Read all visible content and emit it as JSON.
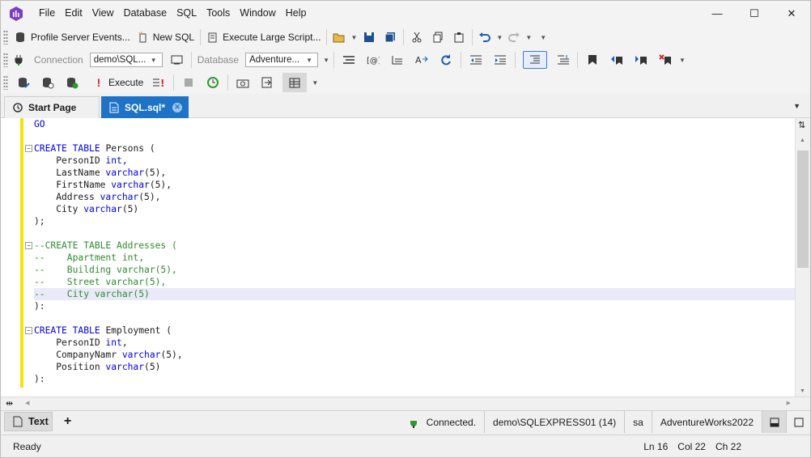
{
  "menu": [
    "File",
    "Edit",
    "View",
    "Database",
    "SQL",
    "Tools",
    "Window",
    "Help"
  ],
  "window_controls": {
    "minimize": "—",
    "maximize": "☐",
    "close": "✕"
  },
  "toolbar1": {
    "profile_events": "Profile Server Events...",
    "new_sql": "New SQL",
    "execute_large": "Execute Large Script..."
  },
  "toolbar2": {
    "connection_label": "Connection",
    "connection_value": "demo\\SQL...",
    "database_label": "Database",
    "database_value": "Adventure..."
  },
  "toolbar3": {
    "execute": "Execute"
  },
  "tabs": {
    "start": "Start Page",
    "sql": "SQL.sql*"
  },
  "code": [
    {
      "t": "GO",
      "c": "kw"
    },
    {
      "t": "",
      "c": ""
    },
    {
      "t": "CREATE TABLE Persons (",
      "c": "mix1",
      "fold": true
    },
    {
      "t": "    PersonID int,",
      "c": "mix2"
    },
    {
      "t": "    LastName varchar(5),",
      "c": "mix2"
    },
    {
      "t": "    FirstName varchar(5),",
      "c": "mix2"
    },
    {
      "t": "    Address varchar(5),",
      "c": "mix2"
    },
    {
      "t": "    City varchar(5)",
      "c": "mix2"
    },
    {
      "t": ");",
      "c": ""
    },
    {
      "t": "",
      "c": ""
    },
    {
      "t": "--CREATE TABLE Addresses (",
      "c": "cm",
      "fold": true
    },
    {
      "t": "--    Apartment int,",
      "c": "cm"
    },
    {
      "t": "--    Building varchar(5),",
      "c": "cm"
    },
    {
      "t": "--    Street varchar(5),",
      "c": "cm"
    },
    {
      "t": "--    City varchar(5)",
      "c": "cm",
      "hl": true
    },
    {
      "t": "):",
      "c": "kw"
    },
    {
      "t": "",
      "c": ""
    },
    {
      "t": "CREATE TABLE Employment (",
      "c": "mix1",
      "fold": true
    },
    {
      "t": "    PersonID int,",
      "c": "mix2"
    },
    {
      "t": "    CompanyNamr varchar(5),",
      "c": "mix2"
    },
    {
      "t": "    Position varchar(5)",
      "c": "mix2"
    },
    {
      "t": "):",
      "c": "kw"
    }
  ],
  "bottom": {
    "text_tab": "Text",
    "add": "+"
  },
  "connection_status": {
    "state": "Connected.",
    "server": "demo\\SQLEXPRESS01 (14)",
    "user": "sa",
    "database": "AdventureWorks2022"
  },
  "status": {
    "ready": "Ready",
    "ln": "Ln 16",
    "col": "Col 22",
    "ch": "Ch 22"
  },
  "colors": {
    "accent": "#1e73c7",
    "keyword": "#0000e6",
    "comment": "#2e8b2e",
    "gutter": "#f2e600"
  }
}
